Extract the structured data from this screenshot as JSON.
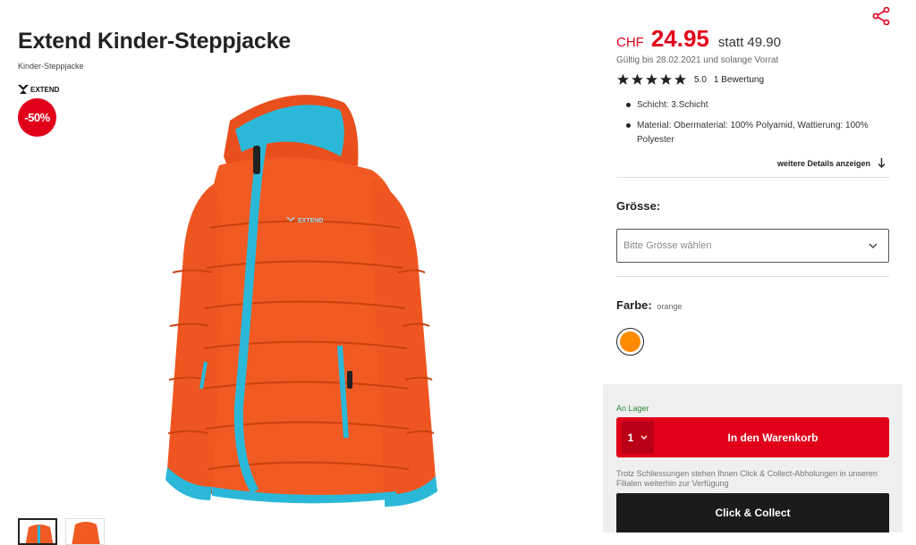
{
  "product": {
    "title": "Extend Kinder-Steppjacke",
    "subtitle": "Kinder-Steppjacke",
    "brand": "EXTEND",
    "discount": "-50%"
  },
  "pricing": {
    "currency": "CHF",
    "price": "24.95",
    "old_price": "statt 49.90",
    "validity": "Gültig bis 28.02.2021 und solange Vorrat"
  },
  "rating": {
    "stars": 5,
    "score": "5.0",
    "reviews": "1 Bewertung"
  },
  "features": [
    "Schicht: 3.Schicht",
    "Material: Obermaterial: 100% Polyamid, Wattierung: 100% Polyester"
  ],
  "details_link": "weitere Details anzeigen",
  "size": {
    "label": "Grösse:",
    "placeholder": "Bitte Grösse wählen"
  },
  "color": {
    "label": "Farbe:",
    "value": "orange",
    "swatch": "#ff8a00"
  },
  "cart": {
    "stock": "An Lager",
    "quantity": "1",
    "add_to_cart": "In den Warenkorb",
    "notice": "Trotz Schliessungen stehen Ihnen Click & Collect-Abholungen in unseren Filialen weiterhin zur Verfügung",
    "click_collect": "Click & Collect"
  },
  "colors": {
    "accent": "#e1001a",
    "jacket": "#f15a22",
    "trim": "#2bb8d8",
    "stock_green": "#2f8a3b"
  },
  "icons": [
    "share-icon",
    "brand-logo-icon",
    "star-icon",
    "arrow-down-icon",
    "chevron-down-icon"
  ]
}
